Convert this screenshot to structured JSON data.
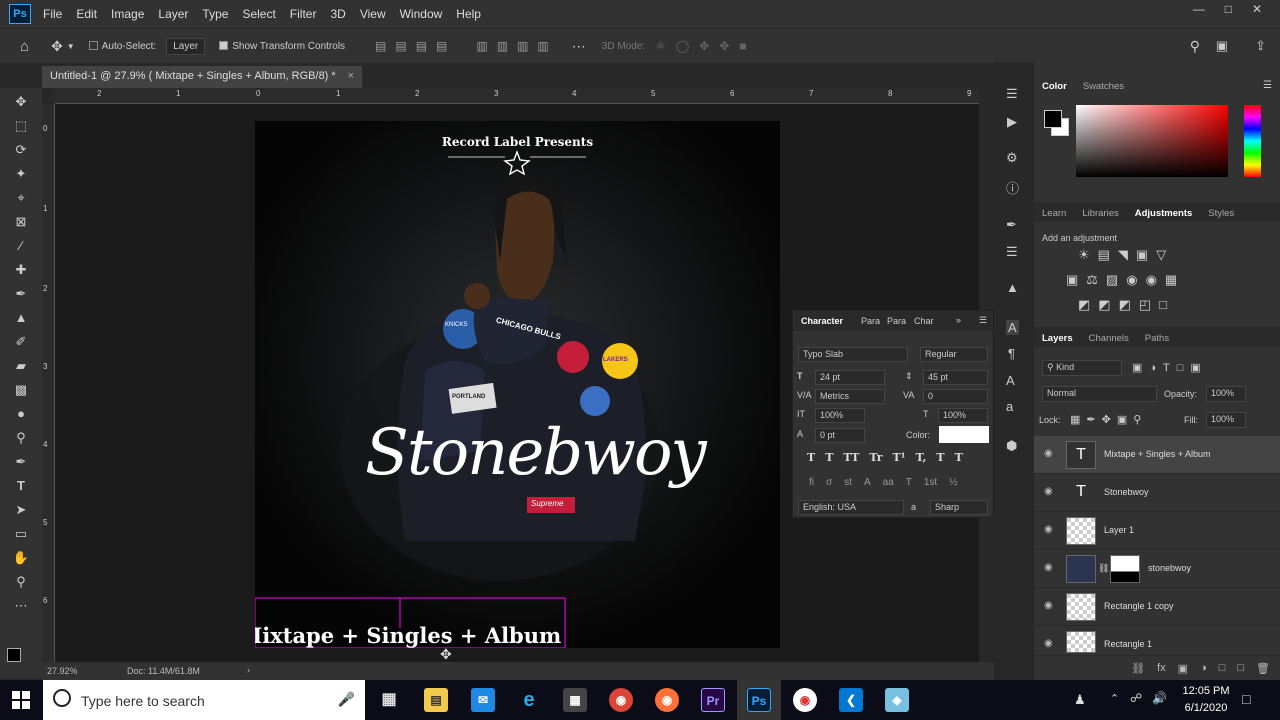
{
  "app": {
    "logo": "Ps",
    "menus": [
      "File",
      "Edit",
      "Image",
      "Layer",
      "Type",
      "Select",
      "Filter",
      "3D",
      "View",
      "Window",
      "Help"
    ]
  },
  "options": {
    "auto_select": "Auto-Select:",
    "layer_select": "Layer",
    "show_transform": "Show Transform Controls",
    "mode_3d": "3D Mode:"
  },
  "document": {
    "tab_title": "Untitled-1 @ 27.9% ( Mixtape + Singles + Album, RGB/8) *",
    "close": "×"
  },
  "ruler": {
    "h": [
      "2",
      "1",
      "0",
      "1",
      "2",
      "3",
      "4",
      "5",
      "6",
      "7",
      "8",
      "9"
    ],
    "v": [
      "0",
      "1",
      "2",
      "3",
      "4",
      "5",
      "6"
    ]
  },
  "artwork": {
    "top_text": "Record Label Presents",
    "script_title": "Stonebwoy",
    "bottom_text": "Mixtape + Singles + Album",
    "jacket_text": "CHICAGO BULLS",
    "patch1": "KNICKS",
    "patch2": "LAKERS",
    "patch3": "PORTLAND",
    "supreme": "Supreme"
  },
  "status": {
    "zoom": "27.92%",
    "doc": "Doc: 11.4M/61.8M"
  },
  "color_panel": {
    "tabs": [
      "Color",
      "Swatches"
    ]
  },
  "adjust_panel": {
    "tabs": [
      "Learn",
      "Libraries",
      "Adjustments",
      "Styles"
    ],
    "add": "Add an adjustment"
  },
  "character": {
    "tabs": [
      "Character",
      "Para",
      "Para",
      "Char"
    ],
    "font": "Typo Slab",
    "style": "Regular",
    "size": "24 pt",
    "leading": "45 pt",
    "kerning": "Metrics",
    "tracking": "0",
    "vscale": "100%",
    "hscale": "100%",
    "baseline": "0 pt",
    "color_label": "Color:",
    "lang": "English: USA",
    "aa_label": "a",
    "aa": "Sharp",
    "format_glyphs": [
      "T",
      "T",
      "TT",
      "Tr",
      "T¹",
      "T,",
      "T",
      "T"
    ],
    "ot_glyphs": [
      "fi",
      "σ",
      "st",
      "A",
      "aa",
      "T",
      "1st",
      "½"
    ]
  },
  "layers_panel": {
    "tabs": [
      "Layers",
      "Channels",
      "Paths"
    ],
    "kind": "Kind",
    "blend": "Normal",
    "opacity_label": "Opacity:",
    "opacity": "100%",
    "lock_label": "Lock:",
    "fill_label": "Fill:",
    "fill": "100%",
    "layers": [
      {
        "name": "Mixtape + Singles + Album",
        "type": "text"
      },
      {
        "name": "Stonebwoy",
        "type": "text"
      },
      {
        "name": "Layer 1",
        "type": "pixel"
      },
      {
        "name": "stonebwoy",
        "type": "masked"
      },
      {
        "name": "Rectangle 1 copy",
        "type": "shape"
      },
      {
        "name": "Rectangle 1",
        "type": "shape"
      }
    ]
  },
  "taskbar": {
    "search": "Type here to search",
    "time": "12:05 PM",
    "date": "6/1/2020"
  },
  "colors": {
    "accent": "#31a8ff",
    "premiere": "#9999ff",
    "selection": "#ff00ff"
  }
}
